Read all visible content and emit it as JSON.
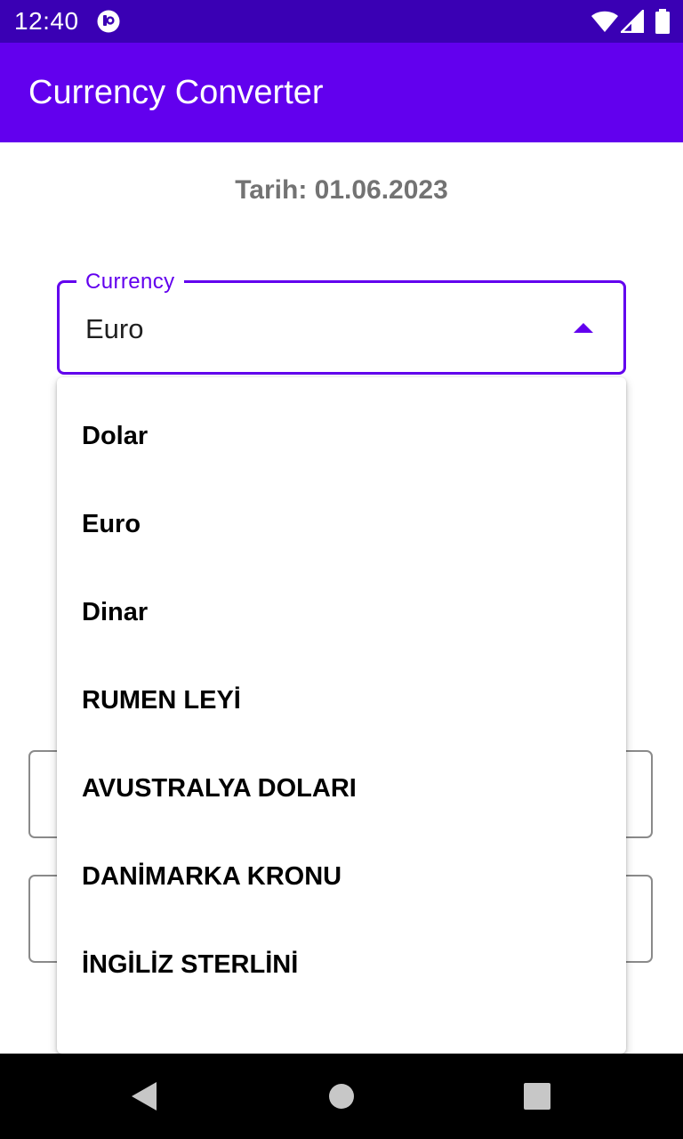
{
  "status_bar": {
    "time": "12:40",
    "icons": [
      "app-notification-icon",
      "wifi-icon",
      "signal-icon",
      "battery-icon"
    ]
  },
  "app_bar": {
    "title": "Currency Converter",
    "color": "#6200ee"
  },
  "date_label": "Tarih: 01.06.2023",
  "currency_field": {
    "label": "Currency",
    "value": "Euro",
    "accent_color": "#6200ee",
    "expanded": true
  },
  "dropdown": {
    "options": [
      "Dolar",
      "Euro",
      "Dinar",
      "RUMEN LEYİ",
      "AVUSTRALYA DOLARI",
      "DANİMARKA KRONU",
      "İNGİLİZ STERLİNİ"
    ]
  },
  "nav_bar": {
    "buttons": [
      "back-icon",
      "home-icon",
      "recents-icon"
    ]
  }
}
